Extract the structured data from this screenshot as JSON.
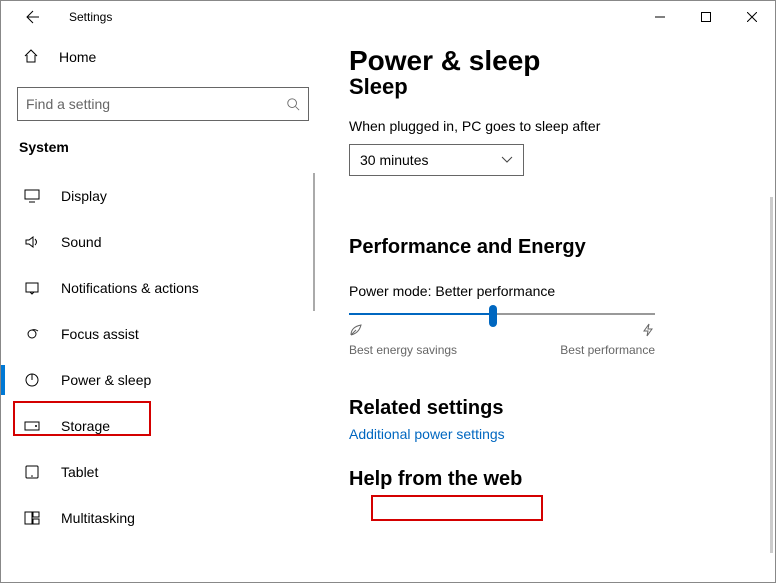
{
  "window": {
    "title": "Settings"
  },
  "sidebar": {
    "home": "Home",
    "search_placeholder": "Find a setting",
    "section": "System",
    "items": [
      {
        "label": "Display",
        "icon": "display"
      },
      {
        "label": "Sound",
        "icon": "sound"
      },
      {
        "label": "Notifications & actions",
        "icon": "notifications"
      },
      {
        "label": "Focus assist",
        "icon": "focus"
      },
      {
        "label": "Power & sleep",
        "icon": "power",
        "selected": true
      },
      {
        "label": "Storage",
        "icon": "storage"
      },
      {
        "label": "Tablet",
        "icon": "tablet"
      },
      {
        "label": "Multitasking",
        "icon": "multitasking"
      }
    ]
  },
  "main": {
    "page_title": "Power & sleep",
    "sleep_heading": "Sleep",
    "sleep_label": "When plugged in, PC goes to sleep after",
    "sleep_value": "30 minutes",
    "perf_heading": "Performance and Energy",
    "power_mode_label": "Power mode: Better performance",
    "slider_min_label": "Best energy savings",
    "slider_max_label": "Best performance",
    "related_heading": "Related settings",
    "related_link": "Additional power settings",
    "help_heading_partial": "Help from the web"
  }
}
